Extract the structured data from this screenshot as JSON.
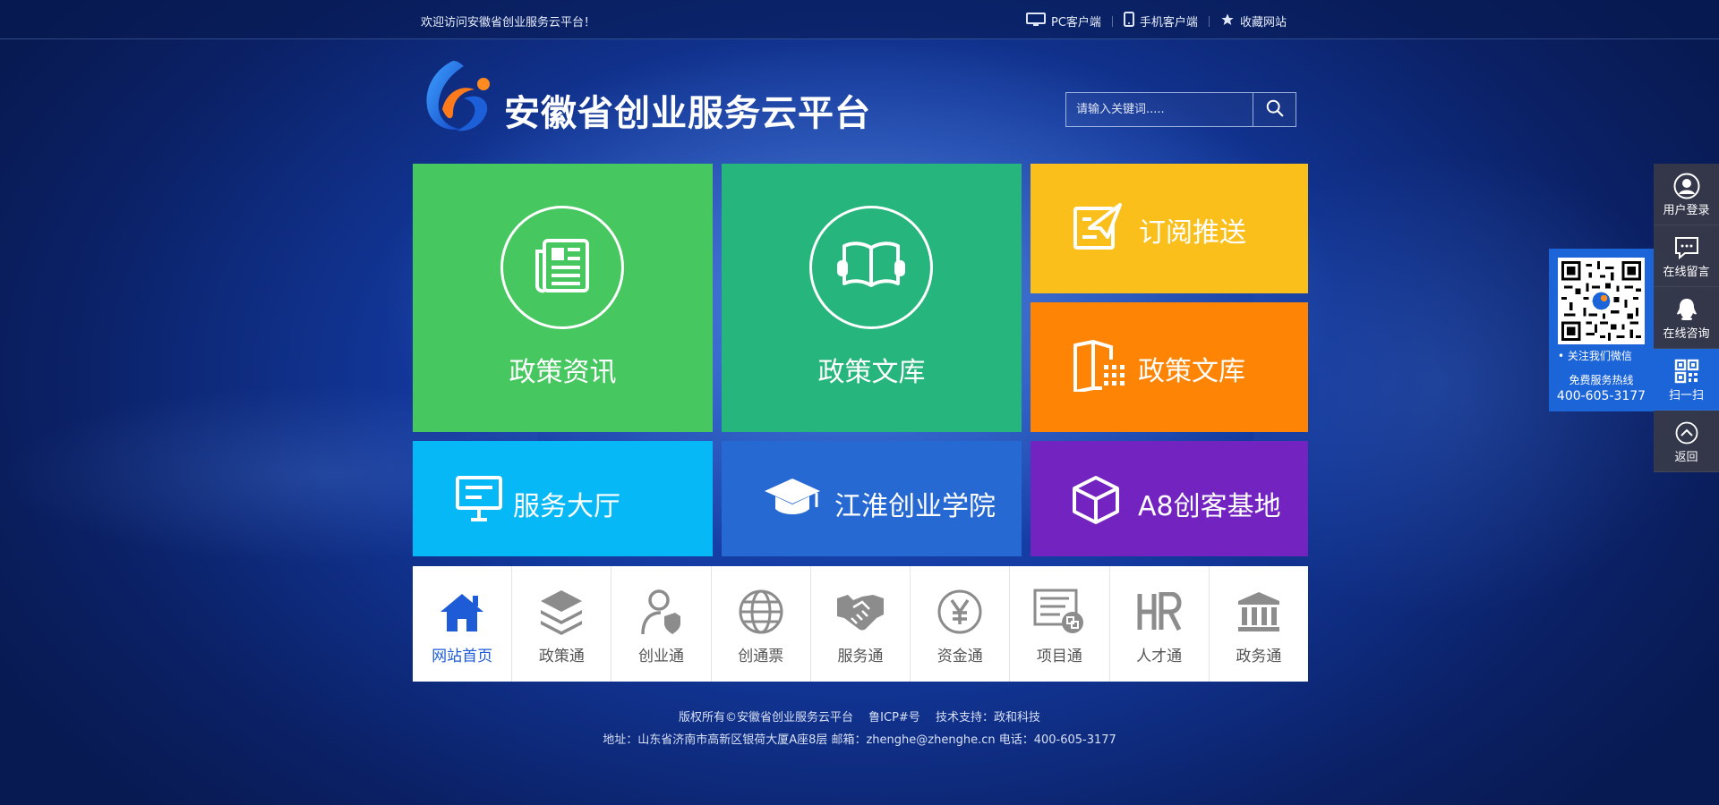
{
  "topbar": {
    "welcome": "欢迎访问安徽省创业服务云平台！",
    "links": [
      {
        "label": "PC客户端",
        "icon": "monitor-icon"
      },
      {
        "label": "手机客户端",
        "icon": "mobile-icon"
      },
      {
        "label": "收藏网站",
        "icon": "star-icon"
      }
    ]
  },
  "header": {
    "site_title": "安徽省创业服务云平台",
    "search_placeholder": "请输入关键词.....",
    "search_icon": "search-icon"
  },
  "tiles": {
    "policy_news": {
      "label": "政策资讯",
      "color": "#47c760",
      "icon": "newspaper-icon"
    },
    "policy_library": {
      "label": "政策文库",
      "color": "#26b57c",
      "icon": "open-book-icon"
    },
    "subscribe": {
      "label": "订阅推送",
      "color": "#fbbf1c",
      "icon": "paper-plane-icon"
    },
    "policy_library_2": {
      "label": "政策文库",
      "color": "#fe8405",
      "icon": "book-grid-icon"
    },
    "service_hall": {
      "label": "服务大厅",
      "color": "#07b8f6",
      "icon": "presentation-board-icon"
    },
    "jianghuai_academy": {
      "label": "江淮创业学院",
      "color": "#2769d3",
      "icon": "graduation-cap-icon"
    },
    "a8_base": {
      "label": "A8创客基地",
      "color": "#7323c0",
      "icon": "cube-icon"
    }
  },
  "bottom_nav": [
    {
      "label": "网站首页",
      "icon": "home-icon",
      "active": true
    },
    {
      "label": "政策通",
      "icon": "layers-icon"
    },
    {
      "label": "创业通",
      "icon": "user-shield-icon"
    },
    {
      "label": "创通票",
      "icon": "globe-icon"
    },
    {
      "label": "服务通",
      "icon": "handshake-icon"
    },
    {
      "label": "资金通",
      "icon": "yen-icon"
    },
    {
      "label": "项目通",
      "icon": "project-list-icon"
    },
    {
      "label": "人才通",
      "icon": "hr-icon"
    },
    {
      "label": "政务通",
      "icon": "government-building-icon"
    }
  ],
  "footer": {
    "line1": "版权所有©安徽省创业服务云平台　 鲁ICP#号　 技术支持：政和科技",
    "line2": "地址：山东省济南市高新区银荷大厦A座8层  邮箱：zhenghe@zhenghe.cn 电话：400-605-3177"
  },
  "side_float": {
    "items": [
      {
        "label": "用户登录",
        "icon": "user-icon"
      },
      {
        "label": "在线留言",
        "icon": "message-icon"
      },
      {
        "label": "在线咨询",
        "icon": "qq-icon"
      },
      {
        "label": "扫一扫",
        "icon": "qr-code-icon"
      },
      {
        "label": "返回",
        "icon": "back-to-top-icon"
      }
    ],
    "qr_panel": {
      "caption": "• 关注我们微信",
      "hotline_label": "免费服务热线",
      "hotline": "400-605-3177"
    }
  }
}
